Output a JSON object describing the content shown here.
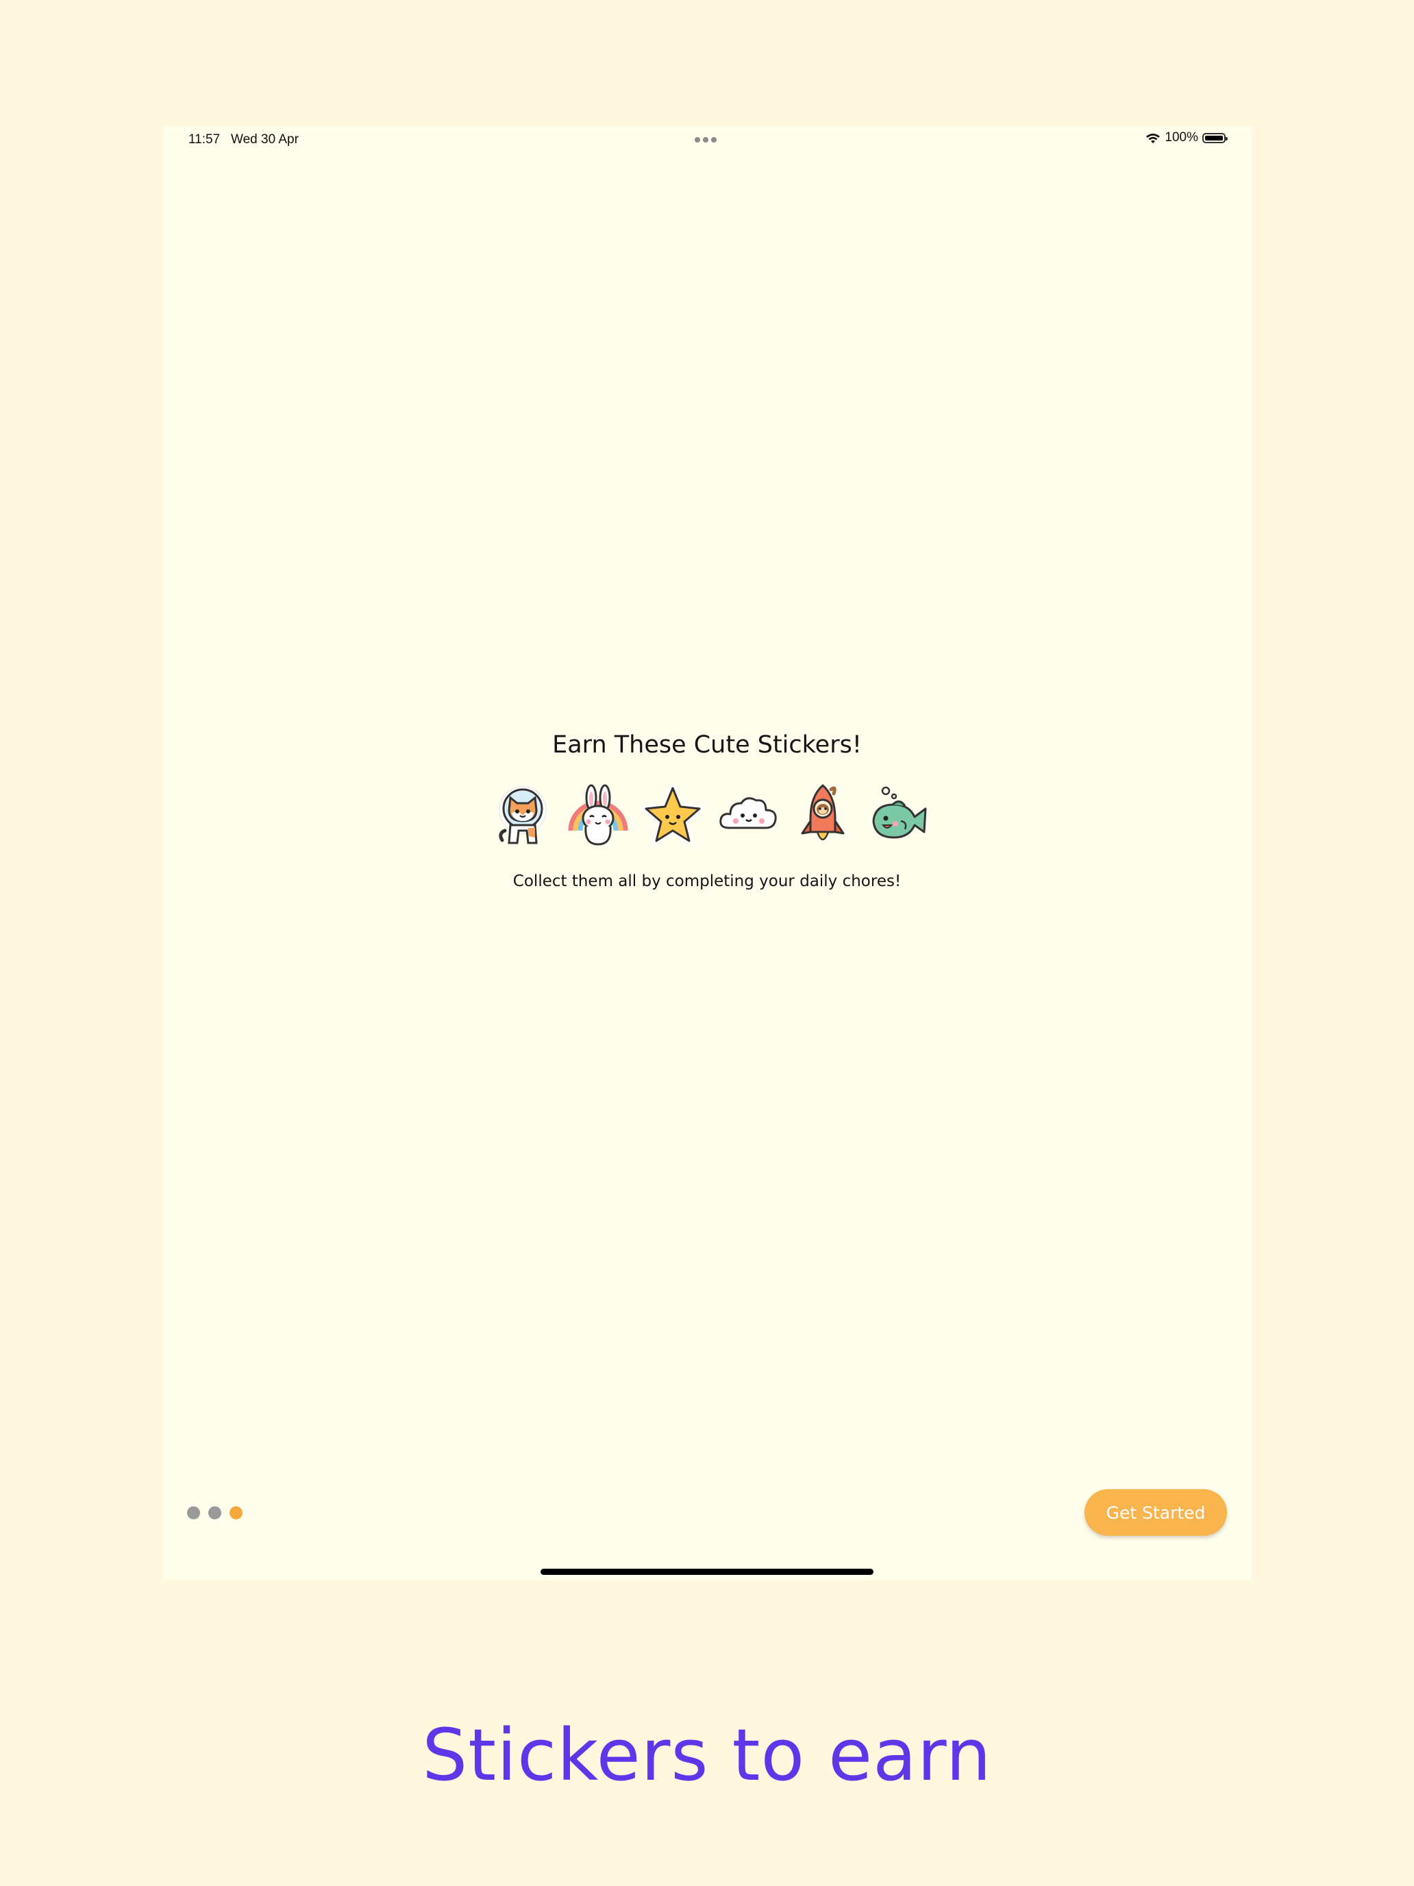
{
  "status_bar": {
    "time": "11:57",
    "date": "Wed 30 Apr",
    "battery": "100%"
  },
  "onboarding": {
    "title": "Earn These Cute Stickers!",
    "subtitle": "Collect them all by completing your daily chores!",
    "stickers": [
      "astronaut-cat-sticker",
      "rainbow-bunny-sticker",
      "smiling-star-sticker",
      "smiling-cloud-sticker",
      "rocket-sloth-sticker",
      "smiling-fish-sticker"
    ],
    "page_indicator": {
      "total": 3,
      "current": 3
    },
    "get_started_label": "Get Started"
  },
  "caption": "Stickers to earn",
  "colors": {
    "background": "#FFF8DF",
    "screen": "#FFFDEB",
    "accent": "#F9B44E",
    "caption": "#6136E8"
  }
}
